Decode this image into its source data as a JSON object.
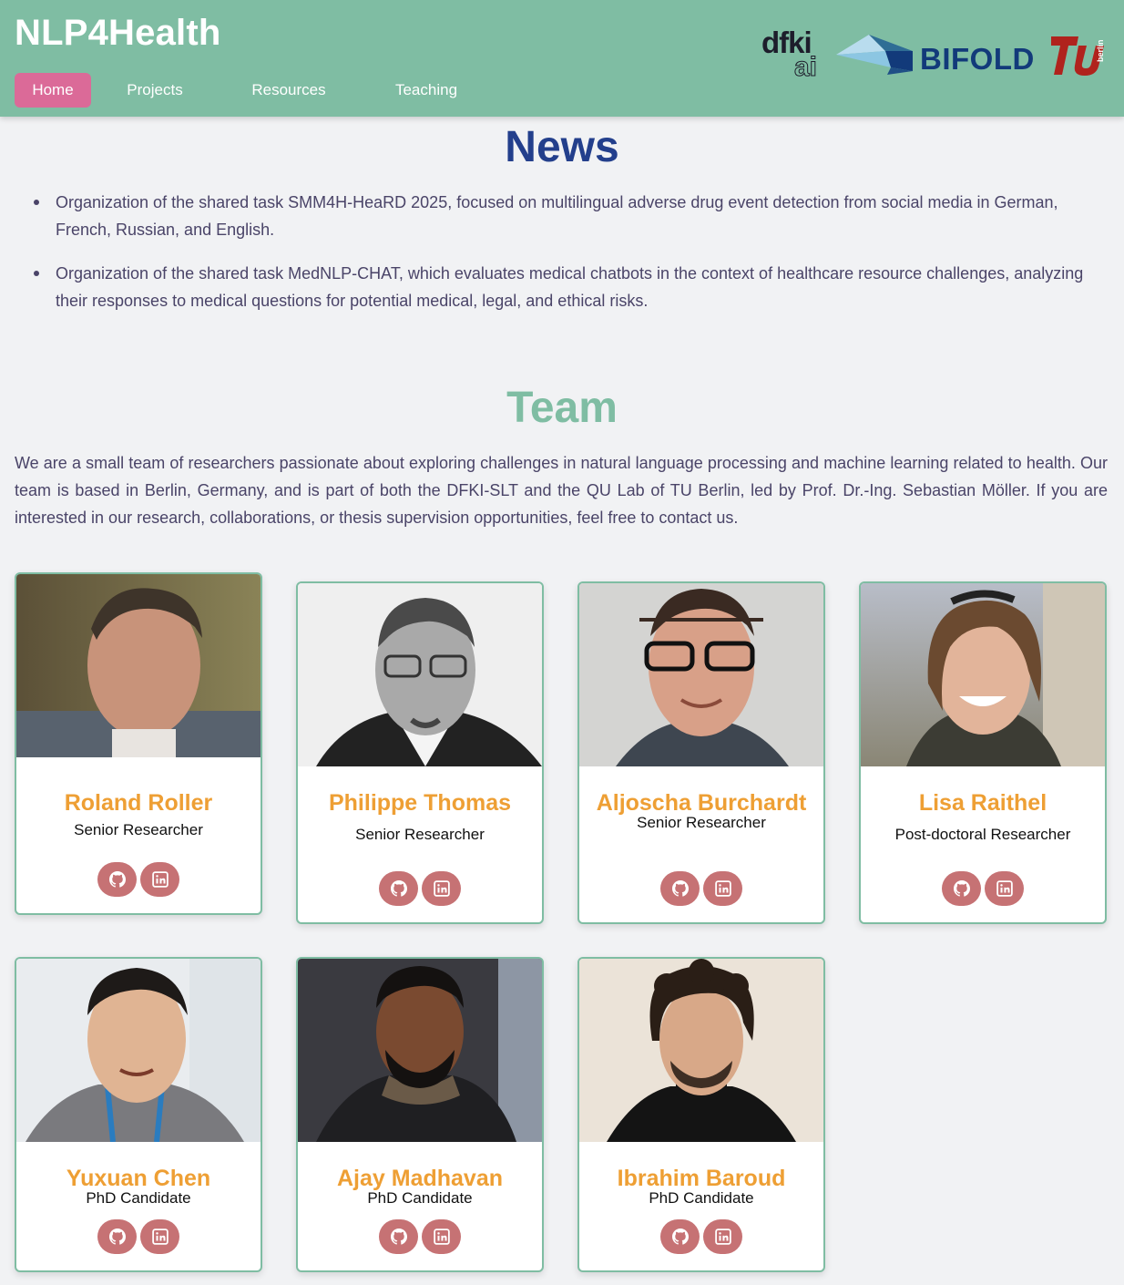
{
  "header": {
    "brand": "NLP4Health",
    "nav": [
      {
        "label": "Home",
        "active": true
      },
      {
        "label": "Projects",
        "active": false
      },
      {
        "label": "Resources",
        "active": false
      },
      {
        "label": "Teaching",
        "active": false
      }
    ],
    "logos": {
      "dfki_top": "dfki",
      "dfki_bottom": "ai",
      "bifold": "BIFOLD",
      "tu": "TU",
      "tu_sub": "berlin"
    }
  },
  "news": {
    "title": "News",
    "items": [
      "Organization of the shared task SMM4H-HeaRD 2025, focused on multilingual adverse drug event detection from social media in German, French, Russian, and English.",
      "Organization of the shared task MedNLP-CHAT, which evaluates medical chatbots in the context of healthcare resource challenges, analyzing their responses to medical questions for potential medical, legal, and ethical risks."
    ]
  },
  "team": {
    "title": "Team",
    "intro": "We are a small team of researchers passionate about exploring challenges in natural language processing and machine learning related to health. Our team is based in Berlin, Germany, and is part of both the DFKI-SLT and the QU Lab of TU Berlin, led by Prof. Dr.-Ing. Sebastian Möller. If you are interested in our research, collaborations, or thesis supervision opportunities, feel free to contact us.",
    "members": [
      {
        "name": "Roland Roller",
        "role": "Senior Researcher"
      },
      {
        "name": "Philippe Thomas",
        "role": "Senior Researcher"
      },
      {
        "name": "Aljoscha Burchardt",
        "role": "Senior Researcher"
      },
      {
        "name": "Lisa Raithel",
        "role": "Post-doctoral Researcher"
      },
      {
        "name": "Yuxuan Chen",
        "role": "PhD Candidate"
      },
      {
        "name": "Ajay Madhavan",
        "role": "PhD Candidate"
      },
      {
        "name": "Ibrahim Baroud",
        "role": "PhD Candidate"
      }
    ],
    "social_icons": [
      "github-icon",
      "linkedin-icon"
    ]
  },
  "colors": {
    "header_bg": "#7fbda3",
    "nav_active": "#db6a98",
    "news_title": "#233f8c",
    "team_title": "#7fbda3",
    "member_name": "#ee9f34",
    "social_button": "#c67274",
    "card_border": "#7fbda3"
  }
}
